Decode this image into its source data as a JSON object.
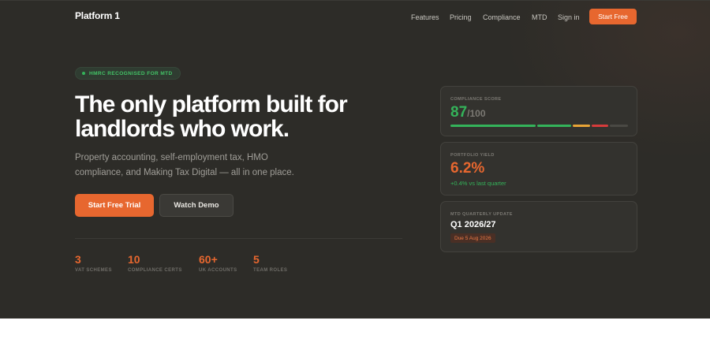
{
  "nav": {
    "logo": "Platform 1",
    "links": [
      "Features",
      "Pricing",
      "Compliance",
      "MTD",
      "Sign in"
    ],
    "cta": "Start Free"
  },
  "hero": {
    "badge": "HMRC RECOGNISED FOR MTD",
    "headline_line1": "The only platform built for",
    "headline_line2": "landlords who work.",
    "sub_line1": "Property accounting, self-employment tax, HMO",
    "sub_line2": "compliance, and Making Tax Digital — all in one place.",
    "primary_button": "Start Free Trial",
    "secondary_button": "Watch Demo"
  },
  "stats": [
    {
      "value": "3",
      "label": "VAT SCHEMES"
    },
    {
      "value": "10",
      "label": "COMPLIANCE CERTS"
    },
    {
      "value": "60+",
      "label": "UK ACCOUNTS"
    },
    {
      "value": "5",
      "label": "TEAM ROLES"
    }
  ],
  "cards": {
    "compliance": {
      "title": "COMPLIANCE SCORE",
      "score": "87",
      "denominator": "/100",
      "segments": [
        {
          "color": "#34b35a"
        },
        {
          "color": "#34b35a"
        },
        {
          "color": "#e8a436"
        },
        {
          "color": "#d63b3b"
        },
        {
          "color": "#4a4944"
        }
      ]
    },
    "yield": {
      "title": "PORTFOLIO YIELD",
      "value": "6.2%",
      "delta": "+0.4% vs last quarter"
    },
    "mtd": {
      "title": "MTD QUARTERLY UPDATE",
      "quarter": "Q1 2026/27",
      "due": "Due 5 Aug 2026"
    }
  },
  "colors": {
    "accent": "#e7672f",
    "success": "#34b35a",
    "background": "#2d2c28"
  }
}
